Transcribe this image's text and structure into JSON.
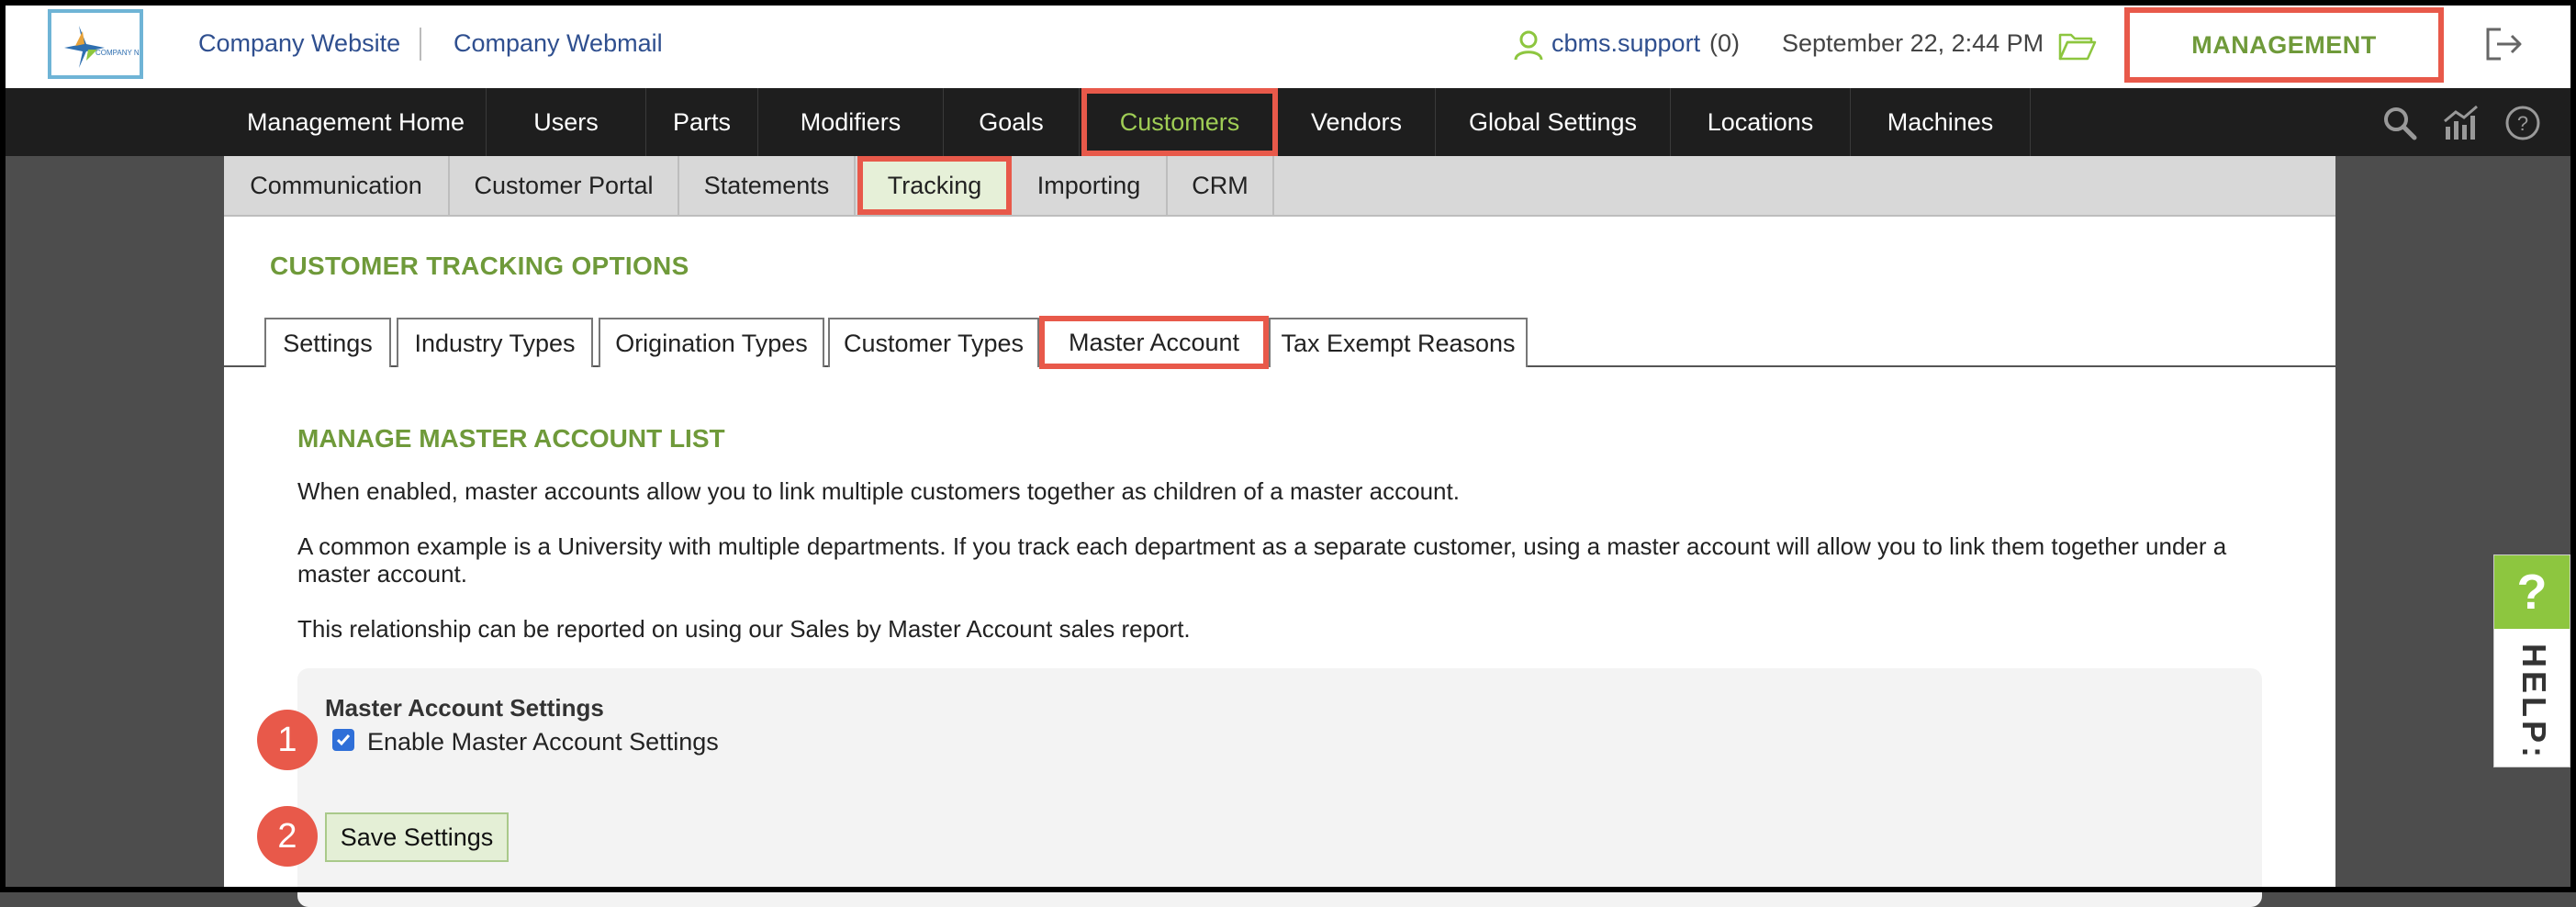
{
  "header": {
    "company_website": "Company Website",
    "company_webmail": "Company Webmail",
    "user_name": "cbms.support",
    "user_count": "(0)",
    "datetime": "September 22, 2:44 PM",
    "management_label": "MANAGEMENT",
    "logo_text": "COMPANY NAME",
    "icons": [
      "user-icon",
      "folder-icon",
      "logout-icon"
    ]
  },
  "main_nav": {
    "items": [
      {
        "label": "Management Home"
      },
      {
        "label": "Users"
      },
      {
        "label": "Parts"
      },
      {
        "label": "Modifiers"
      },
      {
        "label": "Goals"
      },
      {
        "label": "Customers",
        "active": true
      },
      {
        "label": "Vendors"
      },
      {
        "label": "Global Settings"
      },
      {
        "label": "Locations"
      },
      {
        "label": "Machines"
      }
    ],
    "tools": [
      "search-icon",
      "analytics-icon",
      "help-circle-icon"
    ]
  },
  "sub_nav": {
    "items": [
      {
        "label": "Communication"
      },
      {
        "label": "Customer Portal"
      },
      {
        "label": "Statements"
      },
      {
        "label": "Tracking",
        "active": true
      },
      {
        "label": "Importing"
      },
      {
        "label": "CRM"
      }
    ]
  },
  "page": {
    "title": "CUSTOMER TRACKING OPTIONS",
    "tabs": [
      {
        "label": "Settings"
      },
      {
        "label": "Industry Types"
      },
      {
        "label": "Origination Types"
      },
      {
        "label": "Customer Types"
      },
      {
        "label": "Master Account",
        "active": true
      },
      {
        "label": "Tax Exempt Reasons"
      }
    ]
  },
  "master_account": {
    "heading": "MANAGE MASTER ACCOUNT LIST",
    "para1": "When enabled, master accounts allow you to link multiple customers together as children of a master account.",
    "para2": "A common example is a University with multiple departments. If you track each department as a separate customer, using a master account will allow you to link them together under a master account.",
    "para3": "This relationship can be reported on using our Sales by Master Account sales report.",
    "settings_heading": "Master Account Settings",
    "enable_label": "Enable Master Account Settings",
    "enable_checked": true,
    "save_label": "Save Settings"
  },
  "annotations": {
    "badge1": "1",
    "badge2": "2",
    "color": "#e8594a"
  },
  "help": {
    "question": "?",
    "label": "HELP:"
  },
  "colors": {
    "accent_green": "#6f9a3a",
    "nav_bg": "#1e1e1e",
    "highlight": "#e8594a",
    "link_blue": "#2f4f8f"
  }
}
